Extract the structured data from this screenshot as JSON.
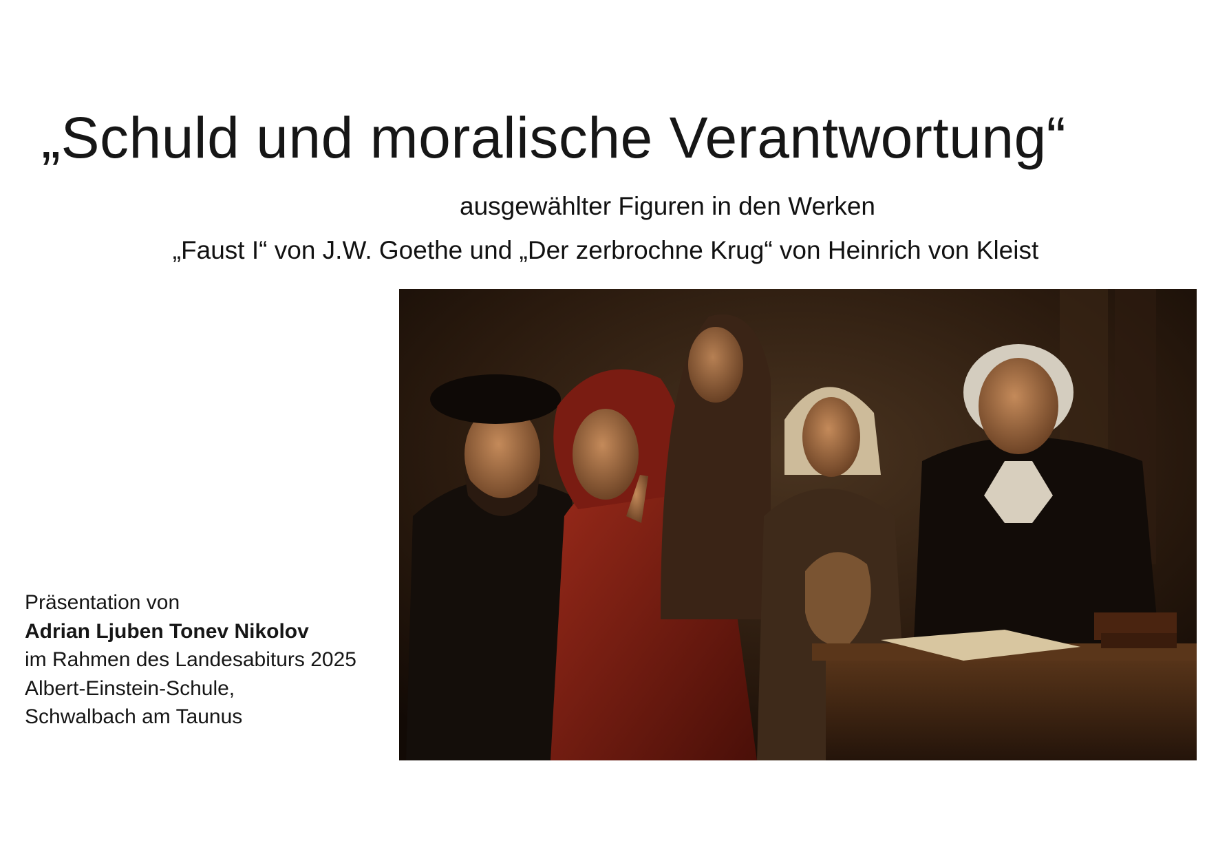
{
  "slide": {
    "title": "„Schuld und moralische Verantwortung“",
    "subtitle_line1": "ausgewählter Figuren in den Werken",
    "subtitle_line2": "„Faust I“ von J.W. Goethe und „Der zerbrochne Krug“ von Heinrich von Kleist"
  },
  "presenter": {
    "intro": "Präsentation von",
    "name": "Adrian Ljuben Tonev Nikolov",
    "context": "im Rahmen des Landesabiturs 2025",
    "school": "Albert-Einstein-Schule,",
    "location": "Schwalbach am Taunus"
  },
  "image": {
    "alt": "",
    "colors": {
      "background": "#2a1a0e",
      "red_robe": "#7a1c12",
      "black_robe": "#140e0a",
      "skin": "#b07a4e",
      "wood": "#4a2c16",
      "paper": "#d8c6a0"
    }
  }
}
